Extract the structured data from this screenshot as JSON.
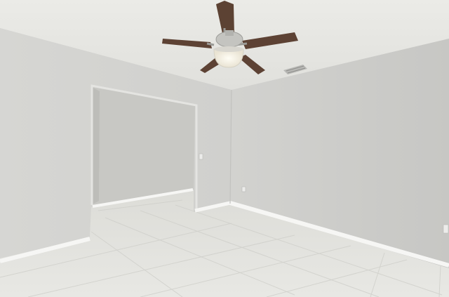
{
  "scene": {
    "description_hidden": "",
    "watermark_text": "",
    "colors": {
      "ceiling": "#e6e6e2",
      "wall_left": "#d4d4d1",
      "wall_back": "#cfcfcc",
      "wall_right": "#cbcbc8",
      "alcove_wall": "#c6c6c2",
      "floor": "#e2e2dd",
      "baseboard": "#f5f5f3",
      "fan_blade": "#5a4032",
      "fan_body": "#bcbcb8",
      "fan_light": "#f4efe2"
    },
    "icons": [
      "ceiling-fan-icon",
      "air-vent-icon",
      "outlet-icon",
      "light-switch-icon"
    ]
  }
}
